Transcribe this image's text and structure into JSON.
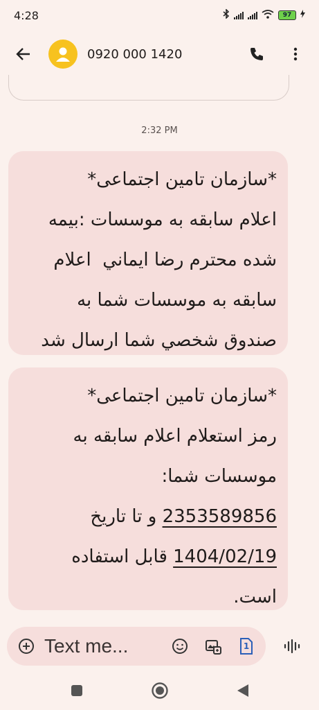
{
  "status_bar": {
    "time": "4:28",
    "battery": "97",
    "icons": [
      "bluetooth-icon",
      "signal-icon",
      "signal-icon",
      "wifi-icon",
      "battery-icon",
      "charging-icon"
    ]
  },
  "header": {
    "contact": "0920 000 1420",
    "icons": [
      "back-arrow-icon",
      "avatar-icon",
      "phone-icon",
      "more-vert-icon"
    ]
  },
  "conversation": {
    "timestamp": "2:32 PM",
    "messages": [
      {
        "line1": "*سازمان تامین اجتماعی*",
        "line2": "اعلام سابقه به موسسات :بيمه",
        "line3": "شده محترم رضا ايماني  اعلام",
        "line4": "سابقه به موسسات شما به",
        "line5": "صندوق شخصي شما ارسال شد"
      },
      {
        "line1": "*سازمان تامین اجتماعی*",
        "line2": "رمز استعلام اعلام سابقه به",
        "line3": "موسسات شما:",
        "code": "2353589856",
        "line4_rest": " و تا تاريخ",
        "date": "1404/02/19",
        "line5_rest": " قابل استفاده",
        "line6": "است."
      }
    ]
  },
  "composer": {
    "placeholder": "Text me...",
    "icons": [
      "add-circle-icon",
      "emoji-icon",
      "gallery-icon",
      "sim-1-icon",
      "voice-wave-icon"
    ],
    "sim_label": "1"
  },
  "nav": {
    "icons": [
      "recents-square-icon",
      "home-circle-icon",
      "back-triangle-icon"
    ]
  },
  "colors": {
    "background": "#fbf1ed",
    "bubble": "#f6dedc",
    "avatar": "#f7c21f",
    "battery": "#6fd14b",
    "sim_accent": "#2b5fb8"
  }
}
